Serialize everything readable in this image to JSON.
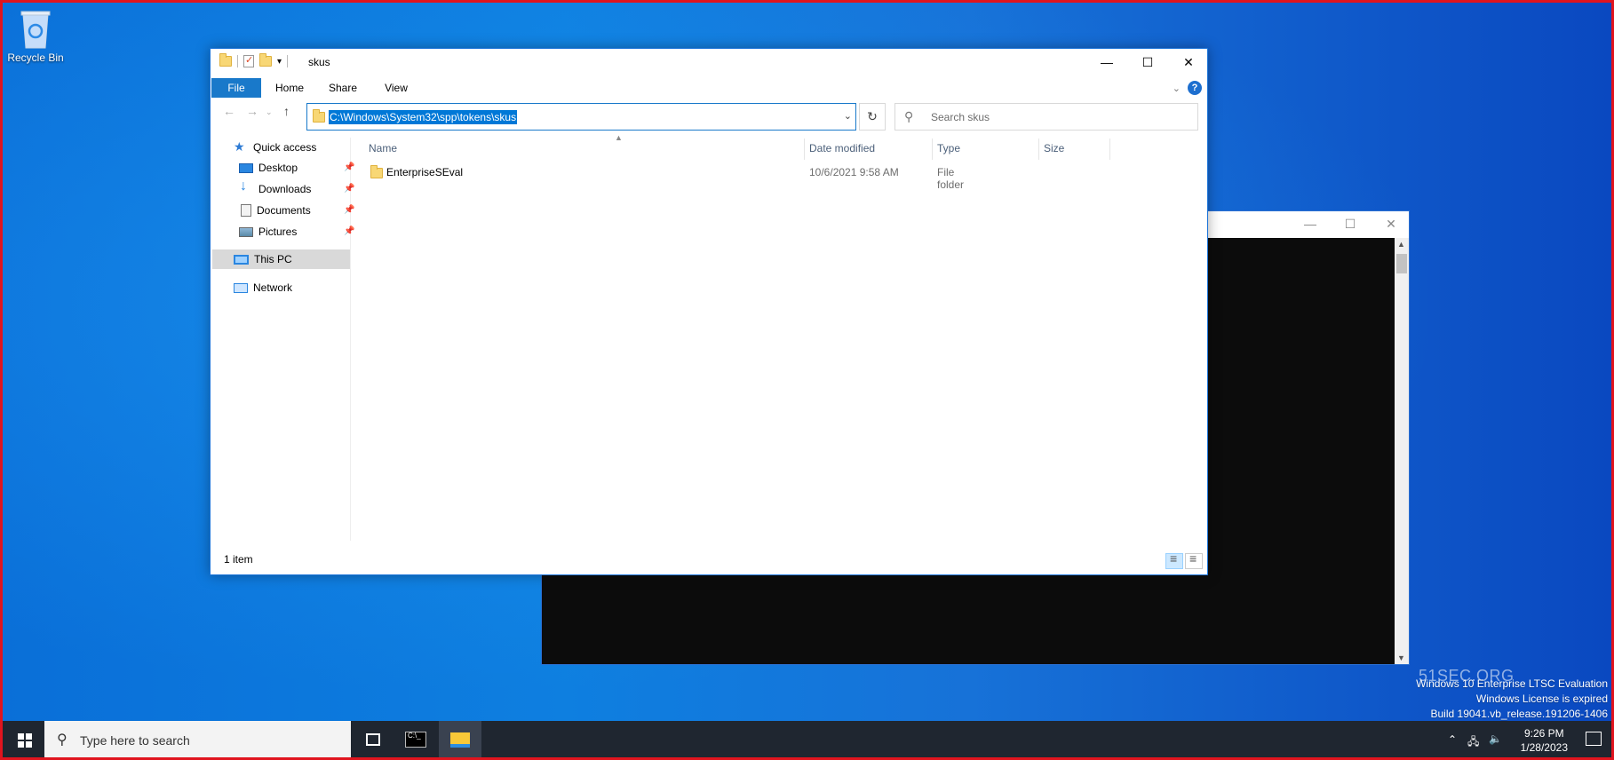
{
  "desktop": {
    "recycle_bin_label": "Recycle Bin",
    "watermark_site": "51SEC.ORG",
    "watermark_lines": [
      "Windows 10 Enterprise LTSC Evaluation",
      "Windows License is expired",
      "Build 19041.vb_release.191206-1406"
    ]
  },
  "explorer": {
    "title": "skus",
    "tabs": [
      "File",
      "Home",
      "Share",
      "View"
    ],
    "address": "C:\\Windows\\System32\\spp\\tokens\\skus",
    "search_placeholder": "Search skus",
    "nav": {
      "quick_access": "Quick access",
      "desktop": "Desktop",
      "downloads": "Downloads",
      "documents": "Documents",
      "pictures": "Pictures",
      "this_pc": "This PC",
      "network": "Network"
    },
    "columns": [
      "Name",
      "Date modified",
      "Type",
      "Size"
    ],
    "rows": [
      {
        "name": "EnterpriseSEval",
        "date": "10/6/2021 9:58 AM",
        "type": "File folder",
        "size": ""
      }
    ],
    "status": "1 item"
  },
  "taskbar": {
    "search_placeholder": "Type here to search",
    "time": "9:26 PM",
    "date": "1/28/2023"
  }
}
